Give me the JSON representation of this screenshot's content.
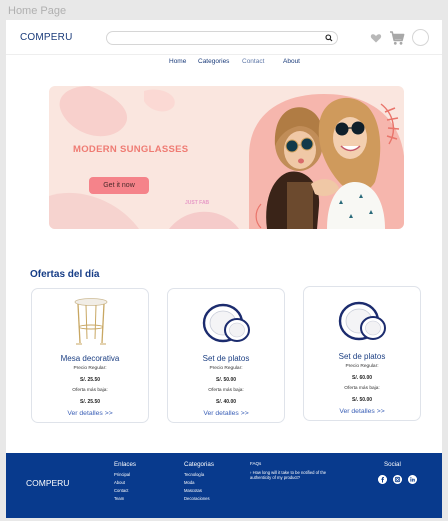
{
  "canvas": {
    "label": "Home Page"
  },
  "header": {
    "brand": "COMPERU",
    "search": {
      "placeholder": ""
    }
  },
  "nav": {
    "items": [
      {
        "label": "Home"
      },
      {
        "label": "Categories"
      },
      {
        "label": "Contact"
      },
      {
        "label": "About"
      }
    ]
  },
  "banner": {
    "title": "MODERN SUNGLASSES",
    "button": "Get it now",
    "logo_text": "JUST FAB"
  },
  "offers": {
    "title": "Ofertas del día",
    "cards": [
      {
        "name": "Mesa decorativa",
        "regular_label": "Precio Regular:",
        "regular_price": "S/. 25.50",
        "offer_label": "Oferta más baja:",
        "offer_price": "S/. 25.50",
        "link": "Ver detalles >>",
        "image": "side-table"
      },
      {
        "name": "Set de platos",
        "regular_label": "Precio Regular:",
        "regular_price": "S/. 50.00",
        "offer_label": "Oferta más baja:",
        "offer_price": "S/. 40.00",
        "link": "Ver detalles >>",
        "image": "plate-set"
      },
      {
        "name": "Set de platos",
        "regular_label": "Precio Regular:",
        "regular_price": "S/. 60.00",
        "offer_label": "Oferta más baja:",
        "offer_price": "S/. 50.00",
        "link": "Ver detalles >>",
        "image": "plate-set"
      }
    ]
  },
  "footer": {
    "brand": "COMPERU",
    "enlaces": {
      "title": "Enlaces",
      "items": [
        "Principal",
        "About",
        "Contact",
        "Team"
      ]
    },
    "categorias": {
      "title": "Categorias",
      "items": [
        "Tecnología",
        "Moda",
        "Mascotas",
        "Decoraciones"
      ]
    },
    "faq": {
      "title": "FAQs",
      "question": "How long will it take to be notified of the authenticity of my product?"
    },
    "social": {
      "title": "Social",
      "icons": [
        "facebook-icon",
        "instagram-icon",
        "linkedin-icon"
      ]
    }
  },
  "colors": {
    "brand_blue": "#153c86",
    "footer_blue": "#083a8d",
    "accent_coral": "#ef7b73",
    "button_pink": "#f5838a",
    "banner_bg": "#fae6df"
  }
}
